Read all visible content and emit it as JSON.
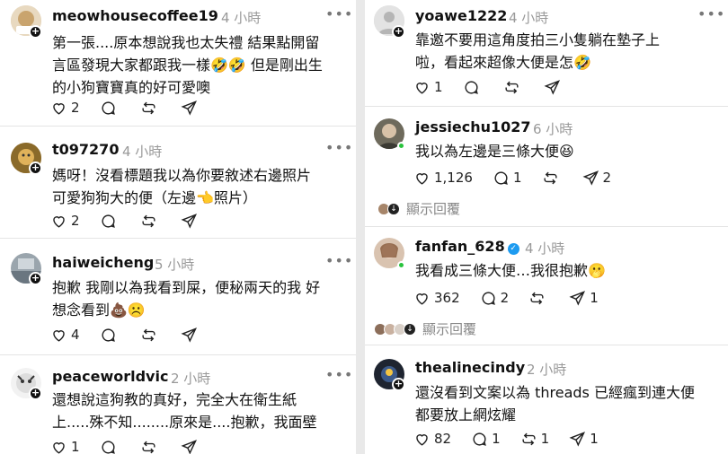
{
  "posts_left": [
    {
      "username": "meowhousecoffee19",
      "time": "4 小時",
      "text_lines": [
        "第一張....原本想說我也太失禮 結果點開留",
        "言區發現大家都跟我一樣🤣🤣 但是剛出生",
        "的小狗寶寶真的好可愛噢"
      ],
      "likes": "2",
      "comments": "",
      "reposts": "",
      "shares": ""
    },
    {
      "username": "t097270",
      "time": "4 小時",
      "text_lines": [
        "媽呀！沒看標題我以為你要敘述右邊照片",
        "可愛狗狗大的便（左邊👈照片）"
      ],
      "likes": "2",
      "comments": "",
      "reposts": "",
      "shares": ""
    },
    {
      "username": "haiweicheng",
      "time": "5 小時",
      "text_lines": [
        "抱歉 我剛以為我看到屎，便秘兩天的我 好",
        "想念看到💩☹️"
      ],
      "likes": "4",
      "comments": "",
      "reposts": "",
      "shares": ""
    },
    {
      "username": "peaceworldvic",
      "time": "2 小時",
      "text_lines": [
        "還想說這狗教的真好，完全大在衛生紙",
        "上.....殊不知........原來是....抱歉，我面壁"
      ],
      "likes": "1",
      "comments": "",
      "reposts": "",
      "shares": ""
    }
  ],
  "posts_right": [
    {
      "username": "yoawe1222",
      "time": "4 小時",
      "text_lines": [
        "靠邀不要用這角度拍三小隻躺在墊子上",
        "啦，看起來超像大便是怎🤣"
      ],
      "likes": "1",
      "comments": "",
      "reposts": "",
      "shares": ""
    },
    {
      "username": "jessiechu1027",
      "time": "6 小時",
      "text_lines": [
        "我以為左邊是三條大便😆"
      ],
      "likes": "1,126",
      "comments": "1",
      "reposts": "",
      "shares": "2",
      "show_replies": "顯示回覆"
    },
    {
      "username": "fanfan_628",
      "time": "4 小時",
      "verified": true,
      "text_lines": [
        "我看成三條大便…我很抱歉🫢"
      ],
      "likes": "362",
      "comments": "2",
      "reposts": "",
      "shares": "1",
      "show_replies": "顯示回覆"
    },
    {
      "username": "thealinecindy",
      "time": "2 小時",
      "text_lines": [
        "還沒看到文案以為 threads 已經瘋到連大便",
        "都要放上網炫耀"
      ],
      "likes": "82",
      "comments": "1",
      "reposts": "1",
      "shares": "1"
    }
  ],
  "more_glyph": "•••",
  "icons": {
    "like": "heart-icon",
    "comment": "comment-bubble-icon",
    "repost": "repost-icon",
    "share": "send-icon",
    "follow": "plus-icon",
    "more": "more-dots-icon"
  },
  "colors": {
    "background": "#ffffff",
    "divider": "#e4e4e4",
    "secondary_text": "#999999",
    "verified": "#1d9bf0",
    "online": "#29c33d"
  }
}
